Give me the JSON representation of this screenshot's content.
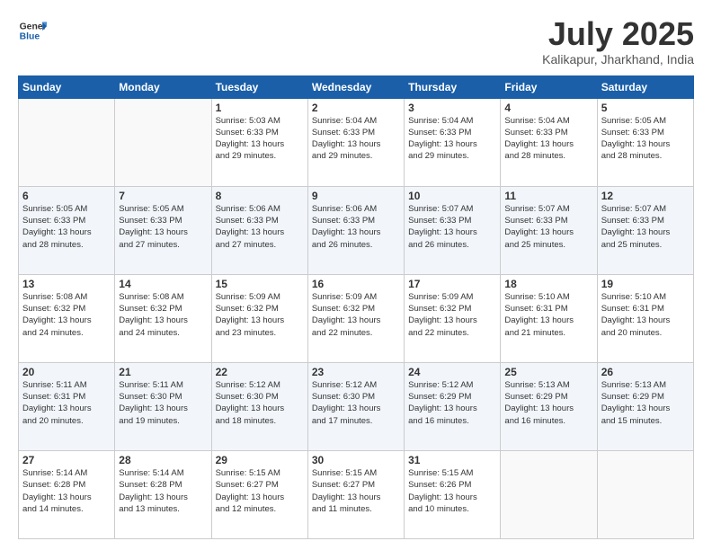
{
  "header": {
    "logo_line1": "General",
    "logo_line2": "Blue",
    "month_year": "July 2025",
    "location": "Kalikapur, Jharkhand, India"
  },
  "weekdays": [
    "Sunday",
    "Monday",
    "Tuesday",
    "Wednesday",
    "Thursday",
    "Friday",
    "Saturday"
  ],
  "weeks": [
    [
      {
        "day": "",
        "info": ""
      },
      {
        "day": "",
        "info": ""
      },
      {
        "day": "1",
        "info": "Sunrise: 5:03 AM\nSunset: 6:33 PM\nDaylight: 13 hours\nand 29 minutes."
      },
      {
        "day": "2",
        "info": "Sunrise: 5:04 AM\nSunset: 6:33 PM\nDaylight: 13 hours\nand 29 minutes."
      },
      {
        "day": "3",
        "info": "Sunrise: 5:04 AM\nSunset: 6:33 PM\nDaylight: 13 hours\nand 29 minutes."
      },
      {
        "day": "4",
        "info": "Sunrise: 5:04 AM\nSunset: 6:33 PM\nDaylight: 13 hours\nand 28 minutes."
      },
      {
        "day": "5",
        "info": "Sunrise: 5:05 AM\nSunset: 6:33 PM\nDaylight: 13 hours\nand 28 minutes."
      }
    ],
    [
      {
        "day": "6",
        "info": "Sunrise: 5:05 AM\nSunset: 6:33 PM\nDaylight: 13 hours\nand 28 minutes."
      },
      {
        "day": "7",
        "info": "Sunrise: 5:05 AM\nSunset: 6:33 PM\nDaylight: 13 hours\nand 27 minutes."
      },
      {
        "day": "8",
        "info": "Sunrise: 5:06 AM\nSunset: 6:33 PM\nDaylight: 13 hours\nand 27 minutes."
      },
      {
        "day": "9",
        "info": "Sunrise: 5:06 AM\nSunset: 6:33 PM\nDaylight: 13 hours\nand 26 minutes."
      },
      {
        "day": "10",
        "info": "Sunrise: 5:07 AM\nSunset: 6:33 PM\nDaylight: 13 hours\nand 26 minutes."
      },
      {
        "day": "11",
        "info": "Sunrise: 5:07 AM\nSunset: 6:33 PM\nDaylight: 13 hours\nand 25 minutes."
      },
      {
        "day": "12",
        "info": "Sunrise: 5:07 AM\nSunset: 6:33 PM\nDaylight: 13 hours\nand 25 minutes."
      }
    ],
    [
      {
        "day": "13",
        "info": "Sunrise: 5:08 AM\nSunset: 6:32 PM\nDaylight: 13 hours\nand 24 minutes."
      },
      {
        "day": "14",
        "info": "Sunrise: 5:08 AM\nSunset: 6:32 PM\nDaylight: 13 hours\nand 24 minutes."
      },
      {
        "day": "15",
        "info": "Sunrise: 5:09 AM\nSunset: 6:32 PM\nDaylight: 13 hours\nand 23 minutes."
      },
      {
        "day": "16",
        "info": "Sunrise: 5:09 AM\nSunset: 6:32 PM\nDaylight: 13 hours\nand 22 minutes."
      },
      {
        "day": "17",
        "info": "Sunrise: 5:09 AM\nSunset: 6:32 PM\nDaylight: 13 hours\nand 22 minutes."
      },
      {
        "day": "18",
        "info": "Sunrise: 5:10 AM\nSunset: 6:31 PM\nDaylight: 13 hours\nand 21 minutes."
      },
      {
        "day": "19",
        "info": "Sunrise: 5:10 AM\nSunset: 6:31 PM\nDaylight: 13 hours\nand 20 minutes."
      }
    ],
    [
      {
        "day": "20",
        "info": "Sunrise: 5:11 AM\nSunset: 6:31 PM\nDaylight: 13 hours\nand 20 minutes."
      },
      {
        "day": "21",
        "info": "Sunrise: 5:11 AM\nSunset: 6:30 PM\nDaylight: 13 hours\nand 19 minutes."
      },
      {
        "day": "22",
        "info": "Sunrise: 5:12 AM\nSunset: 6:30 PM\nDaylight: 13 hours\nand 18 minutes."
      },
      {
        "day": "23",
        "info": "Sunrise: 5:12 AM\nSunset: 6:30 PM\nDaylight: 13 hours\nand 17 minutes."
      },
      {
        "day": "24",
        "info": "Sunrise: 5:12 AM\nSunset: 6:29 PM\nDaylight: 13 hours\nand 16 minutes."
      },
      {
        "day": "25",
        "info": "Sunrise: 5:13 AM\nSunset: 6:29 PM\nDaylight: 13 hours\nand 16 minutes."
      },
      {
        "day": "26",
        "info": "Sunrise: 5:13 AM\nSunset: 6:29 PM\nDaylight: 13 hours\nand 15 minutes."
      }
    ],
    [
      {
        "day": "27",
        "info": "Sunrise: 5:14 AM\nSunset: 6:28 PM\nDaylight: 13 hours\nand 14 minutes."
      },
      {
        "day": "28",
        "info": "Sunrise: 5:14 AM\nSunset: 6:28 PM\nDaylight: 13 hours\nand 13 minutes."
      },
      {
        "day": "29",
        "info": "Sunrise: 5:15 AM\nSunset: 6:27 PM\nDaylight: 13 hours\nand 12 minutes."
      },
      {
        "day": "30",
        "info": "Sunrise: 5:15 AM\nSunset: 6:27 PM\nDaylight: 13 hours\nand 11 minutes."
      },
      {
        "day": "31",
        "info": "Sunrise: 5:15 AM\nSunset: 6:26 PM\nDaylight: 13 hours\nand 10 minutes."
      },
      {
        "day": "",
        "info": ""
      },
      {
        "day": "",
        "info": ""
      }
    ]
  ]
}
